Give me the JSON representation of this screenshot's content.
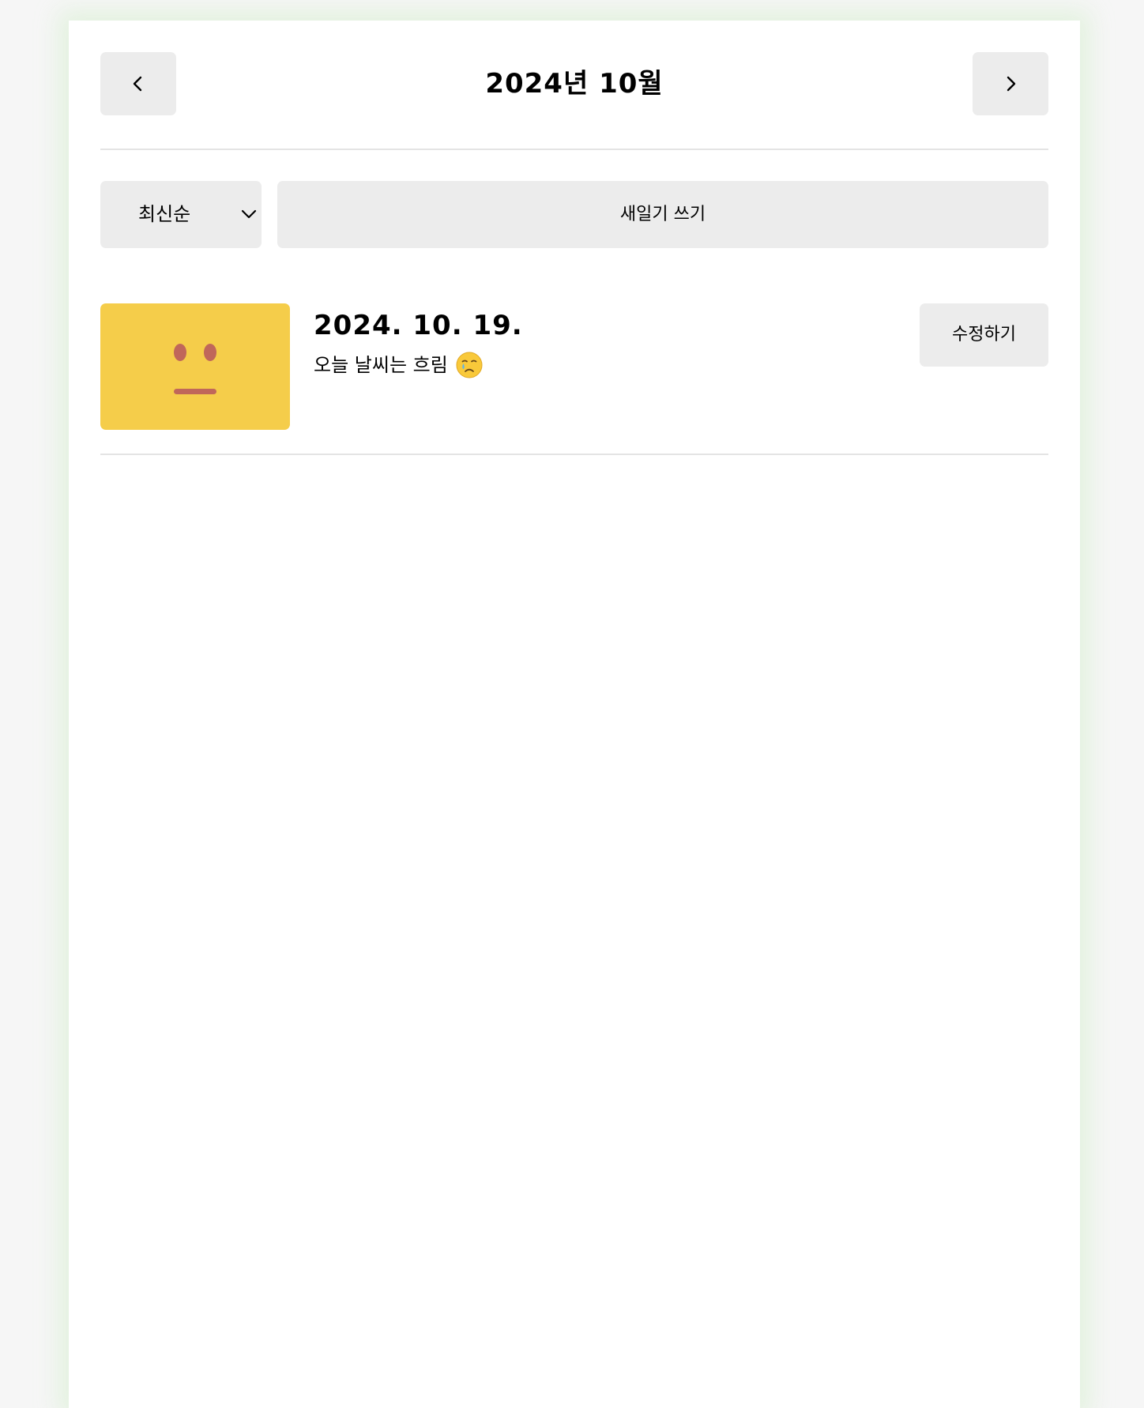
{
  "header": {
    "title": "2024년 10월",
    "prev_icon": "chevron-left-icon",
    "next_icon": "chevron-right-icon"
  },
  "menu": {
    "sort": {
      "selected": "최신순",
      "icon": "chevron-down-icon"
    },
    "new_button_label": "새일기 쓰기"
  },
  "diary_list": [
    {
      "date": "2024. 10. 19.",
      "content": "오늘 날씨는 흐림",
      "content_emoji": "crying-face-icon",
      "emotion_icon": "neutral-face-icon",
      "emotion_color": "#f5cd4a",
      "edit_label": "수정하기"
    }
  ],
  "colors": {
    "page_background": "#f6f6f6",
    "panel_background": "#ffffff",
    "button_background": "#ececec",
    "emotion_face_feature": "#c0675a"
  }
}
